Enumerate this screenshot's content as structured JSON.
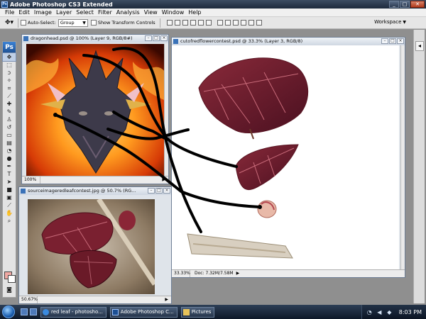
{
  "app": {
    "title": "Adobe Photoshop CS3 Extended",
    "badge": "Ps"
  },
  "menu": [
    "File",
    "Edit",
    "Image",
    "Layer",
    "Select",
    "Filter",
    "Analysis",
    "View",
    "Window",
    "Help"
  ],
  "options": {
    "auto_select_label": "Auto-Select:",
    "auto_select_value": "Group",
    "show_transform_label": "Show Transform Controls",
    "workspace_label": "Workspace"
  },
  "toolbox": {
    "logo": "Ps"
  },
  "docs": {
    "dragon": {
      "title": "dragonhead.psd @ 100% (Layer 9, RGB/8#)",
      "zoom": "100%"
    },
    "leafsrc": {
      "title": "sourceimageredleafcontest.jpg @ 50.7% (RG...",
      "zoom": "50.67%"
    },
    "flower": {
      "title": "cutofredflowercontest.psd @ 33.3% (Layer 3, RGB/8)",
      "zoom": "33.33%",
      "doc": "Doc: 7.32M/7.58M"
    }
  },
  "taskbar": {
    "items": [
      {
        "label": "red leaf - photosho...",
        "icon": "browser-icon"
      },
      {
        "label": "Adobe Photoshop C...",
        "icon": "photoshop-icon"
      },
      {
        "label": "Pictures",
        "icon": "folder-icon"
      }
    ],
    "clock": "8:03 PM"
  },
  "colors": {
    "foreground": "#f0a9a4",
    "background": "#ffffff",
    "accent": "#1c4f93"
  }
}
